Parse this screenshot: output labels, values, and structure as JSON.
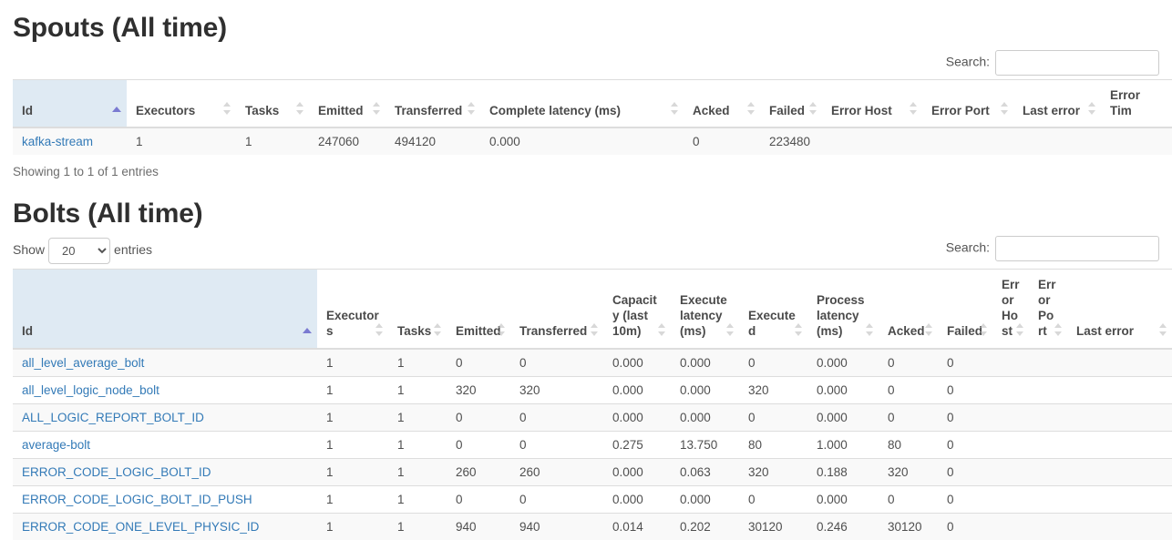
{
  "spouts": {
    "title": "Spouts (All time)",
    "search_label": "Search:",
    "search_value": "",
    "search_placeholder": "",
    "columns": [
      "Id",
      "Executors",
      "Tasks",
      "Emitted",
      "Transferred",
      "Complete latency (ms)",
      "Acked",
      "Failed",
      "Error Host",
      "Error Port",
      "Last error",
      "Error Tim"
    ],
    "sorted_column": "Id",
    "sort_direction": "asc",
    "rows": [
      {
        "id": "kafka-stream",
        "executors": "1",
        "tasks": "1",
        "emitted": "247060",
        "transferred": "494120",
        "complete_latency": "0.000",
        "acked": "0",
        "failed": "223480",
        "error_host": "",
        "error_port": "",
        "last_error": "",
        "error_time": ""
      }
    ],
    "info": "Showing 1 to 1 of 1 entries"
  },
  "bolts": {
    "title": "Bolts (All time)",
    "show_label": "Show",
    "entries_label": "entries",
    "page_length": "20",
    "page_length_options": [
      "20"
    ],
    "search_label": "Search:",
    "search_value": "",
    "search_placeholder": "",
    "columns": [
      "Id",
      "Executors",
      "Tasks",
      "Emitted",
      "Transferred",
      "Capacity (last 10m)",
      "Execute latency (ms)",
      "Executed",
      "Process latency (ms)",
      "Acked",
      "Failed",
      "Error Host",
      "Error Port",
      "Last error"
    ],
    "sorted_column": "Id",
    "sort_direction": "asc",
    "rows": [
      {
        "id": "all_level_average_bolt",
        "executors": "1",
        "tasks": "1",
        "emitted": "0",
        "transferred": "0",
        "capacity": "0.000",
        "execute_latency": "0.000",
        "executed": "0",
        "process_latency": "0.000",
        "acked": "0",
        "failed": "0",
        "error_host": "",
        "error_port": "",
        "last_error": ""
      },
      {
        "id": "all_level_logic_node_bolt",
        "executors": "1",
        "tasks": "1",
        "emitted": "320",
        "transferred": "320",
        "capacity": "0.000",
        "execute_latency": "0.000",
        "executed": "320",
        "process_latency": "0.000",
        "acked": "0",
        "failed": "0",
        "error_host": "",
        "error_port": "",
        "last_error": ""
      },
      {
        "id": "ALL_LOGIC_REPORT_BOLT_ID",
        "executors": "1",
        "tasks": "1",
        "emitted": "0",
        "transferred": "0",
        "capacity": "0.000",
        "execute_latency": "0.000",
        "executed": "0",
        "process_latency": "0.000",
        "acked": "0",
        "failed": "0",
        "error_host": "",
        "error_port": "",
        "last_error": ""
      },
      {
        "id": "average-bolt",
        "executors": "1",
        "tasks": "1",
        "emitted": "0",
        "transferred": "0",
        "capacity": "0.275",
        "execute_latency": "13.750",
        "executed": "80",
        "process_latency": "1.000",
        "acked": "80",
        "failed": "0",
        "error_host": "",
        "error_port": "",
        "last_error": ""
      },
      {
        "id": "ERROR_CODE_LOGIC_BOLT_ID",
        "executors": "1",
        "tasks": "1",
        "emitted": "260",
        "transferred": "260",
        "capacity": "0.000",
        "execute_latency": "0.063",
        "executed": "320",
        "process_latency": "0.188",
        "acked": "320",
        "failed": "0",
        "error_host": "",
        "error_port": "",
        "last_error": ""
      },
      {
        "id": "ERROR_CODE_LOGIC_BOLT_ID_PUSH",
        "executors": "1",
        "tasks": "1",
        "emitted": "0",
        "transferred": "0",
        "capacity": "0.000",
        "execute_latency": "0.000",
        "executed": "0",
        "process_latency": "0.000",
        "acked": "0",
        "failed": "0",
        "error_host": "",
        "error_port": "",
        "last_error": ""
      },
      {
        "id": "ERROR_CODE_ONE_LEVEL_PHYSIC_ID",
        "executors": "1",
        "tasks": "1",
        "emitted": "940",
        "transferred": "940",
        "capacity": "0.014",
        "execute_latency": "0.202",
        "executed": "30120",
        "process_latency": "0.246",
        "acked": "30120",
        "failed": "0",
        "error_host": "",
        "error_port": "",
        "last_error": ""
      }
    ]
  },
  "colors": {
    "link": "#337ab7",
    "sorted_header_bg": "#dfeaf3",
    "sort_arrow": "#7a7ad1",
    "row_stripe": "#f9f9f9",
    "border": "#dddddd"
  }
}
